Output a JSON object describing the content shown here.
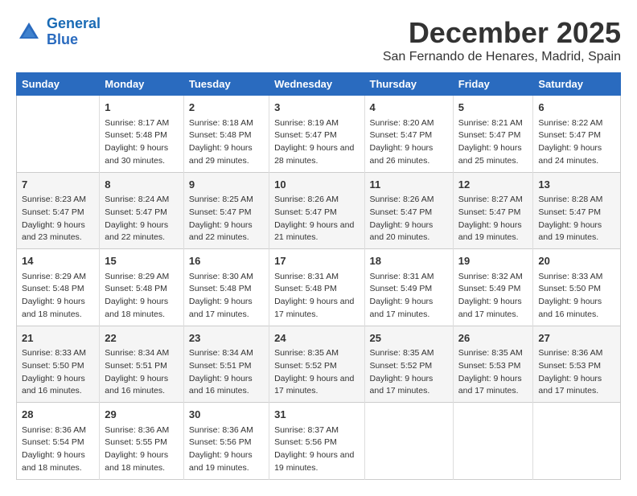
{
  "header": {
    "logo_line1": "General",
    "logo_line2": "Blue",
    "month": "December 2025",
    "location": "San Fernando de Henares, Madrid, Spain"
  },
  "weekdays": [
    "Sunday",
    "Monday",
    "Tuesday",
    "Wednesday",
    "Thursday",
    "Friday",
    "Saturday"
  ],
  "weeks": [
    [
      {
        "day": "",
        "sunrise": "",
        "sunset": "",
        "daylight": ""
      },
      {
        "day": "1",
        "sunrise": "Sunrise: 8:17 AM",
        "sunset": "Sunset: 5:48 PM",
        "daylight": "Daylight: 9 hours and 30 minutes."
      },
      {
        "day": "2",
        "sunrise": "Sunrise: 8:18 AM",
        "sunset": "Sunset: 5:48 PM",
        "daylight": "Daylight: 9 hours and 29 minutes."
      },
      {
        "day": "3",
        "sunrise": "Sunrise: 8:19 AM",
        "sunset": "Sunset: 5:47 PM",
        "daylight": "Daylight: 9 hours and 28 minutes."
      },
      {
        "day": "4",
        "sunrise": "Sunrise: 8:20 AM",
        "sunset": "Sunset: 5:47 PM",
        "daylight": "Daylight: 9 hours and 26 minutes."
      },
      {
        "day": "5",
        "sunrise": "Sunrise: 8:21 AM",
        "sunset": "Sunset: 5:47 PM",
        "daylight": "Daylight: 9 hours and 25 minutes."
      },
      {
        "day": "6",
        "sunrise": "Sunrise: 8:22 AM",
        "sunset": "Sunset: 5:47 PM",
        "daylight": "Daylight: 9 hours and 24 minutes."
      }
    ],
    [
      {
        "day": "7",
        "sunrise": "Sunrise: 8:23 AM",
        "sunset": "Sunset: 5:47 PM",
        "daylight": "Daylight: 9 hours and 23 minutes."
      },
      {
        "day": "8",
        "sunrise": "Sunrise: 8:24 AM",
        "sunset": "Sunset: 5:47 PM",
        "daylight": "Daylight: 9 hours and 22 minutes."
      },
      {
        "day": "9",
        "sunrise": "Sunrise: 8:25 AM",
        "sunset": "Sunset: 5:47 PM",
        "daylight": "Daylight: 9 hours and 22 minutes."
      },
      {
        "day": "10",
        "sunrise": "Sunrise: 8:26 AM",
        "sunset": "Sunset: 5:47 PM",
        "daylight": "Daylight: 9 hours and 21 minutes."
      },
      {
        "day": "11",
        "sunrise": "Sunrise: 8:26 AM",
        "sunset": "Sunset: 5:47 PM",
        "daylight": "Daylight: 9 hours and 20 minutes."
      },
      {
        "day": "12",
        "sunrise": "Sunrise: 8:27 AM",
        "sunset": "Sunset: 5:47 PM",
        "daylight": "Daylight: 9 hours and 19 minutes."
      },
      {
        "day": "13",
        "sunrise": "Sunrise: 8:28 AM",
        "sunset": "Sunset: 5:47 PM",
        "daylight": "Daylight: 9 hours and 19 minutes."
      }
    ],
    [
      {
        "day": "14",
        "sunrise": "Sunrise: 8:29 AM",
        "sunset": "Sunset: 5:48 PM",
        "daylight": "Daylight: 9 hours and 18 minutes."
      },
      {
        "day": "15",
        "sunrise": "Sunrise: 8:29 AM",
        "sunset": "Sunset: 5:48 PM",
        "daylight": "Daylight: 9 hours and 18 minutes."
      },
      {
        "day": "16",
        "sunrise": "Sunrise: 8:30 AM",
        "sunset": "Sunset: 5:48 PM",
        "daylight": "Daylight: 9 hours and 17 minutes."
      },
      {
        "day": "17",
        "sunrise": "Sunrise: 8:31 AM",
        "sunset": "Sunset: 5:48 PM",
        "daylight": "Daylight: 9 hours and 17 minutes."
      },
      {
        "day": "18",
        "sunrise": "Sunrise: 8:31 AM",
        "sunset": "Sunset: 5:49 PM",
        "daylight": "Daylight: 9 hours and 17 minutes."
      },
      {
        "day": "19",
        "sunrise": "Sunrise: 8:32 AM",
        "sunset": "Sunset: 5:49 PM",
        "daylight": "Daylight: 9 hours and 17 minutes."
      },
      {
        "day": "20",
        "sunrise": "Sunrise: 8:33 AM",
        "sunset": "Sunset: 5:50 PM",
        "daylight": "Daylight: 9 hours and 16 minutes."
      }
    ],
    [
      {
        "day": "21",
        "sunrise": "Sunrise: 8:33 AM",
        "sunset": "Sunset: 5:50 PM",
        "daylight": "Daylight: 9 hours and 16 minutes."
      },
      {
        "day": "22",
        "sunrise": "Sunrise: 8:34 AM",
        "sunset": "Sunset: 5:51 PM",
        "daylight": "Daylight: 9 hours and 16 minutes."
      },
      {
        "day": "23",
        "sunrise": "Sunrise: 8:34 AM",
        "sunset": "Sunset: 5:51 PM",
        "daylight": "Daylight: 9 hours and 16 minutes."
      },
      {
        "day": "24",
        "sunrise": "Sunrise: 8:35 AM",
        "sunset": "Sunset: 5:52 PM",
        "daylight": "Daylight: 9 hours and 17 minutes."
      },
      {
        "day": "25",
        "sunrise": "Sunrise: 8:35 AM",
        "sunset": "Sunset: 5:52 PM",
        "daylight": "Daylight: 9 hours and 17 minutes."
      },
      {
        "day": "26",
        "sunrise": "Sunrise: 8:35 AM",
        "sunset": "Sunset: 5:53 PM",
        "daylight": "Daylight: 9 hours and 17 minutes."
      },
      {
        "day": "27",
        "sunrise": "Sunrise: 8:36 AM",
        "sunset": "Sunset: 5:53 PM",
        "daylight": "Daylight: 9 hours and 17 minutes."
      }
    ],
    [
      {
        "day": "28",
        "sunrise": "Sunrise: 8:36 AM",
        "sunset": "Sunset: 5:54 PM",
        "daylight": "Daylight: 9 hours and 18 minutes."
      },
      {
        "day": "29",
        "sunrise": "Sunrise: 8:36 AM",
        "sunset": "Sunset: 5:55 PM",
        "daylight": "Daylight: 9 hours and 18 minutes."
      },
      {
        "day": "30",
        "sunrise": "Sunrise: 8:36 AM",
        "sunset": "Sunset: 5:56 PM",
        "daylight": "Daylight: 9 hours and 19 minutes."
      },
      {
        "day": "31",
        "sunrise": "Sunrise: 8:37 AM",
        "sunset": "Sunset: 5:56 PM",
        "daylight": "Daylight: 9 hours and 19 minutes."
      },
      {
        "day": "",
        "sunrise": "",
        "sunset": "",
        "daylight": ""
      },
      {
        "day": "",
        "sunrise": "",
        "sunset": "",
        "daylight": ""
      },
      {
        "day": "",
        "sunrise": "",
        "sunset": "",
        "daylight": ""
      }
    ]
  ]
}
